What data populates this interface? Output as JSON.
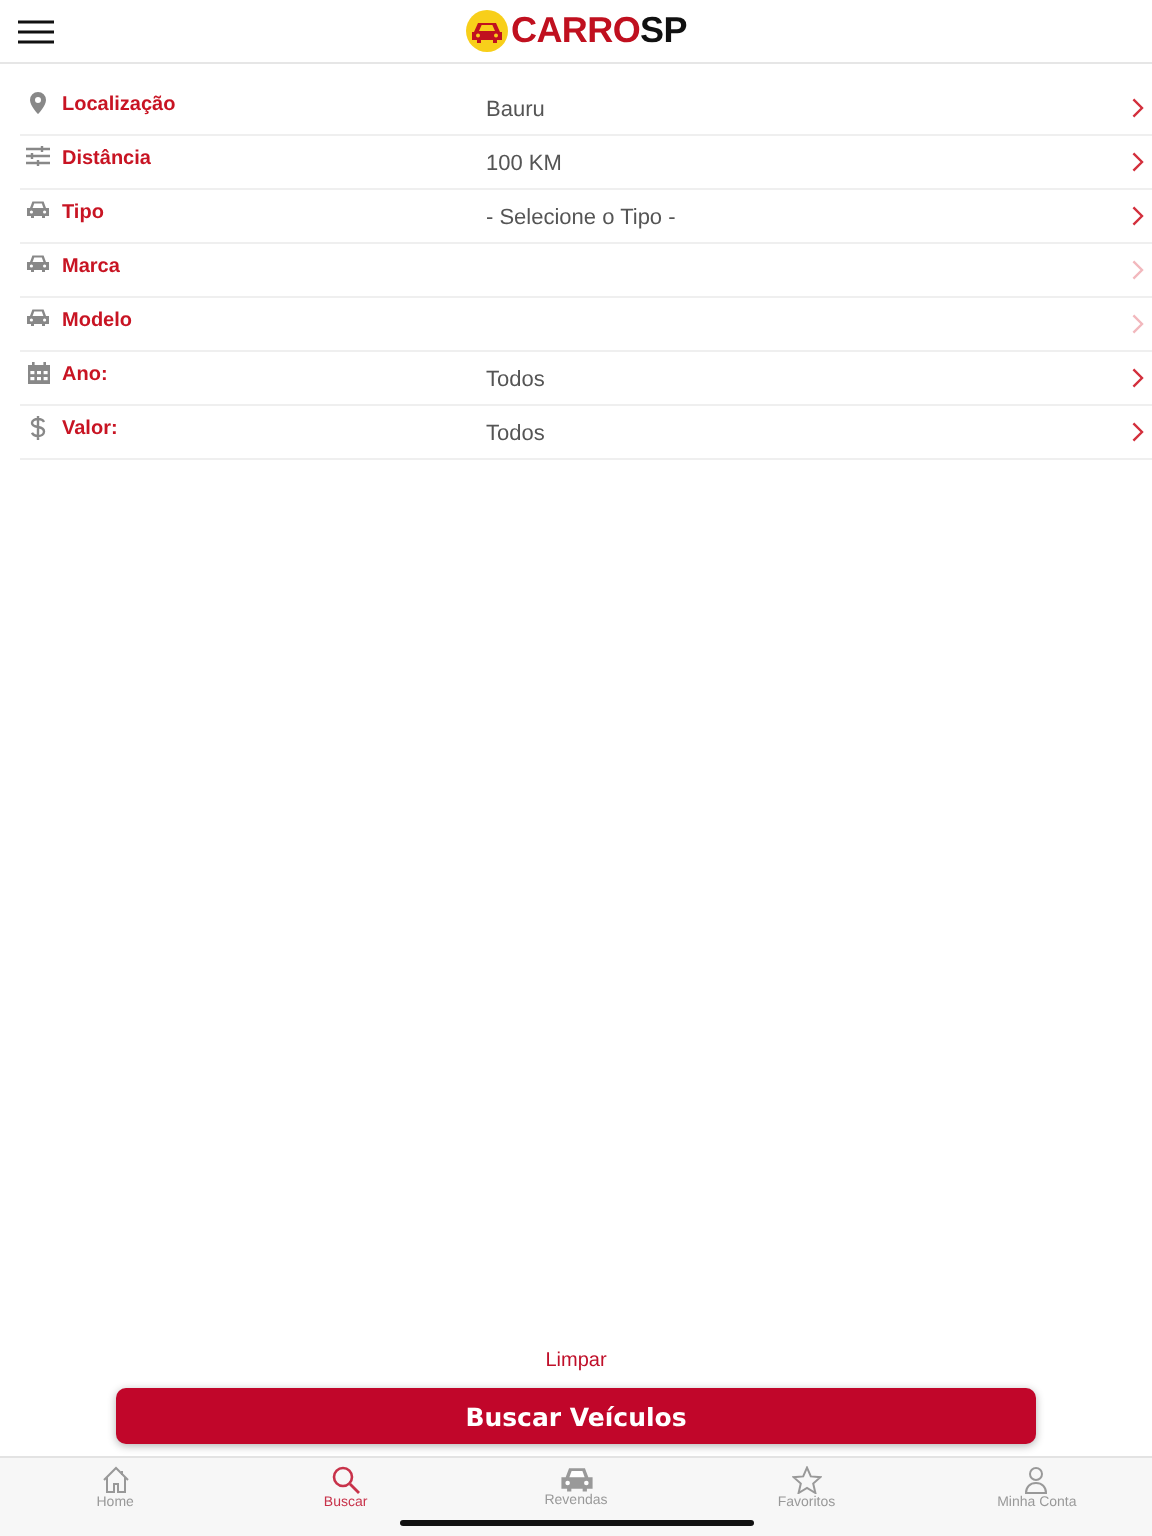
{
  "header": {
    "logo": {
      "part_1": "CARRO",
      "part_2": "SP"
    }
  },
  "filters": [
    {
      "label": "Localização",
      "value": "Bauru",
      "disabled": false
    },
    {
      "label": "Distância",
      "value": "100 KM",
      "disabled": false
    },
    {
      "label": "Tipo",
      "value": "- Selecione o Tipo -",
      "disabled": false
    },
    {
      "label": "Marca",
      "disabled": true
    },
    {
      "label": "Modelo",
      "disabled": true
    },
    {
      "label": "Ano:",
      "value": "Todos",
      "disabled": false
    },
    {
      "label": "Valor:",
      "value": "Todos",
      "disabled": false
    }
  ],
  "clear_link": "Limpar",
  "search_button": "Buscar Veículos",
  "tab_bar": [
    {
      "label": "Home",
      "selected": false
    },
    {
      "label": "Buscar",
      "selected": true
    },
    {
      "label": "Revendas",
      "selected": false
    },
    {
      "label": "Favoritos",
      "selected": false
    },
    {
      "label": "Minha Conta",
      "selected": false
    }
  ]
}
